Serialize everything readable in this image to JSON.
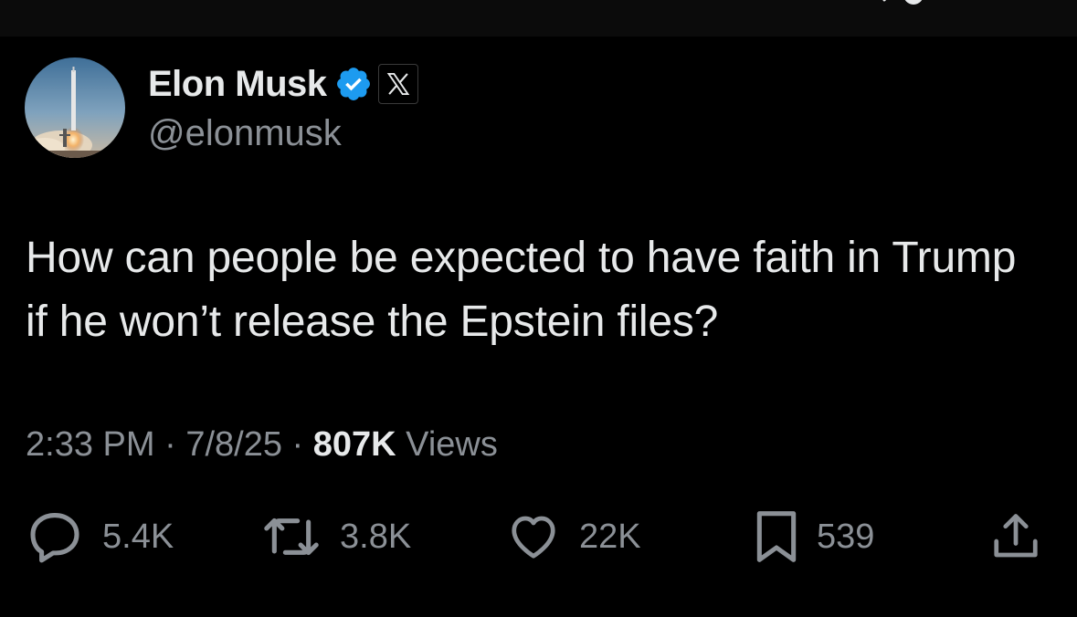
{
  "author": {
    "display_name": "Elon Musk",
    "handle": "@elonmusk",
    "verified": true,
    "affiliation_badge": "x-logo-icon",
    "avatar": "rocket-launch-avatar"
  },
  "tweet": {
    "text": "How can people be expected to have faith in Trump if he won’t release the Epstein files?",
    "time": "2:33 PM",
    "separator": "·",
    "date": "7/8/25",
    "views_count": "807K",
    "views_label": "Views"
  },
  "actions": {
    "replies": "5.4K",
    "reposts": "3.8K",
    "likes": "22K",
    "bookmarks": "539"
  },
  "icons": {
    "reply": "reply-icon",
    "repost": "repost-icon",
    "like": "heart-icon",
    "bookmark": "bookmark-icon",
    "share": "share-icon",
    "verified": "verified-badge-icon"
  },
  "colors": {
    "background": "#000000",
    "primary_text": "#e7e9ea",
    "secondary_text": "#8b9096",
    "verified_blue": "#1d9bf0"
  }
}
